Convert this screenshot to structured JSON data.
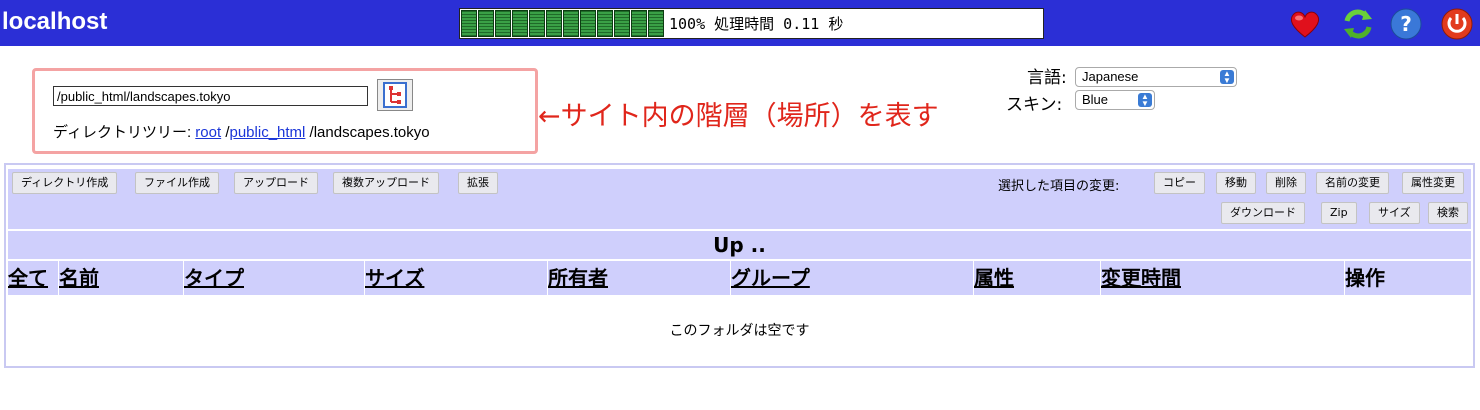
{
  "header": {
    "title": "localhost",
    "progress_text": "100% 処理時間 0.11 秒",
    "progress_cells": 11,
    "icons": [
      "heart-icon",
      "refresh-icon",
      "help-icon",
      "power-icon"
    ]
  },
  "path": {
    "input_value": "/public_html/landscapes.tokyo",
    "tree_label": "ディレクトリツリー:",
    "crumbs": [
      "root",
      "public_html"
    ],
    "current": "/landscapes.tokyo",
    "annotation": "←サイト内の階層（場所）を表す"
  },
  "settings": {
    "language_label": "言語:",
    "language_value": "Japanese",
    "skin_label": "スキン:",
    "skin_value": "Blue"
  },
  "toolbar": {
    "left": [
      "ディレクトリ作成",
      "ファイル作成",
      "アップロード",
      "複数アップロード",
      "拡張"
    ],
    "selected_label": "選択した項目の変更:",
    "right_row1": [
      "コピー",
      "移動",
      "削除",
      "名前の変更",
      "属性変更"
    ],
    "right_row2": [
      "ダウンロード",
      "Zip",
      "サイズ",
      "検索"
    ]
  },
  "table": {
    "up_label": "Up ..",
    "columns": [
      "全て",
      "名前",
      "タイプ",
      "サイズ",
      "所有者",
      "グループ",
      "属性",
      "変更時間",
      "操作"
    ],
    "empty_message": "このフォルダは空です"
  },
  "colors": {
    "header_bg": "#2b2fd6",
    "panel_bg": "#cfcffc",
    "annotation": "#e0261b",
    "highlight_border": "#f4a3a3"
  }
}
